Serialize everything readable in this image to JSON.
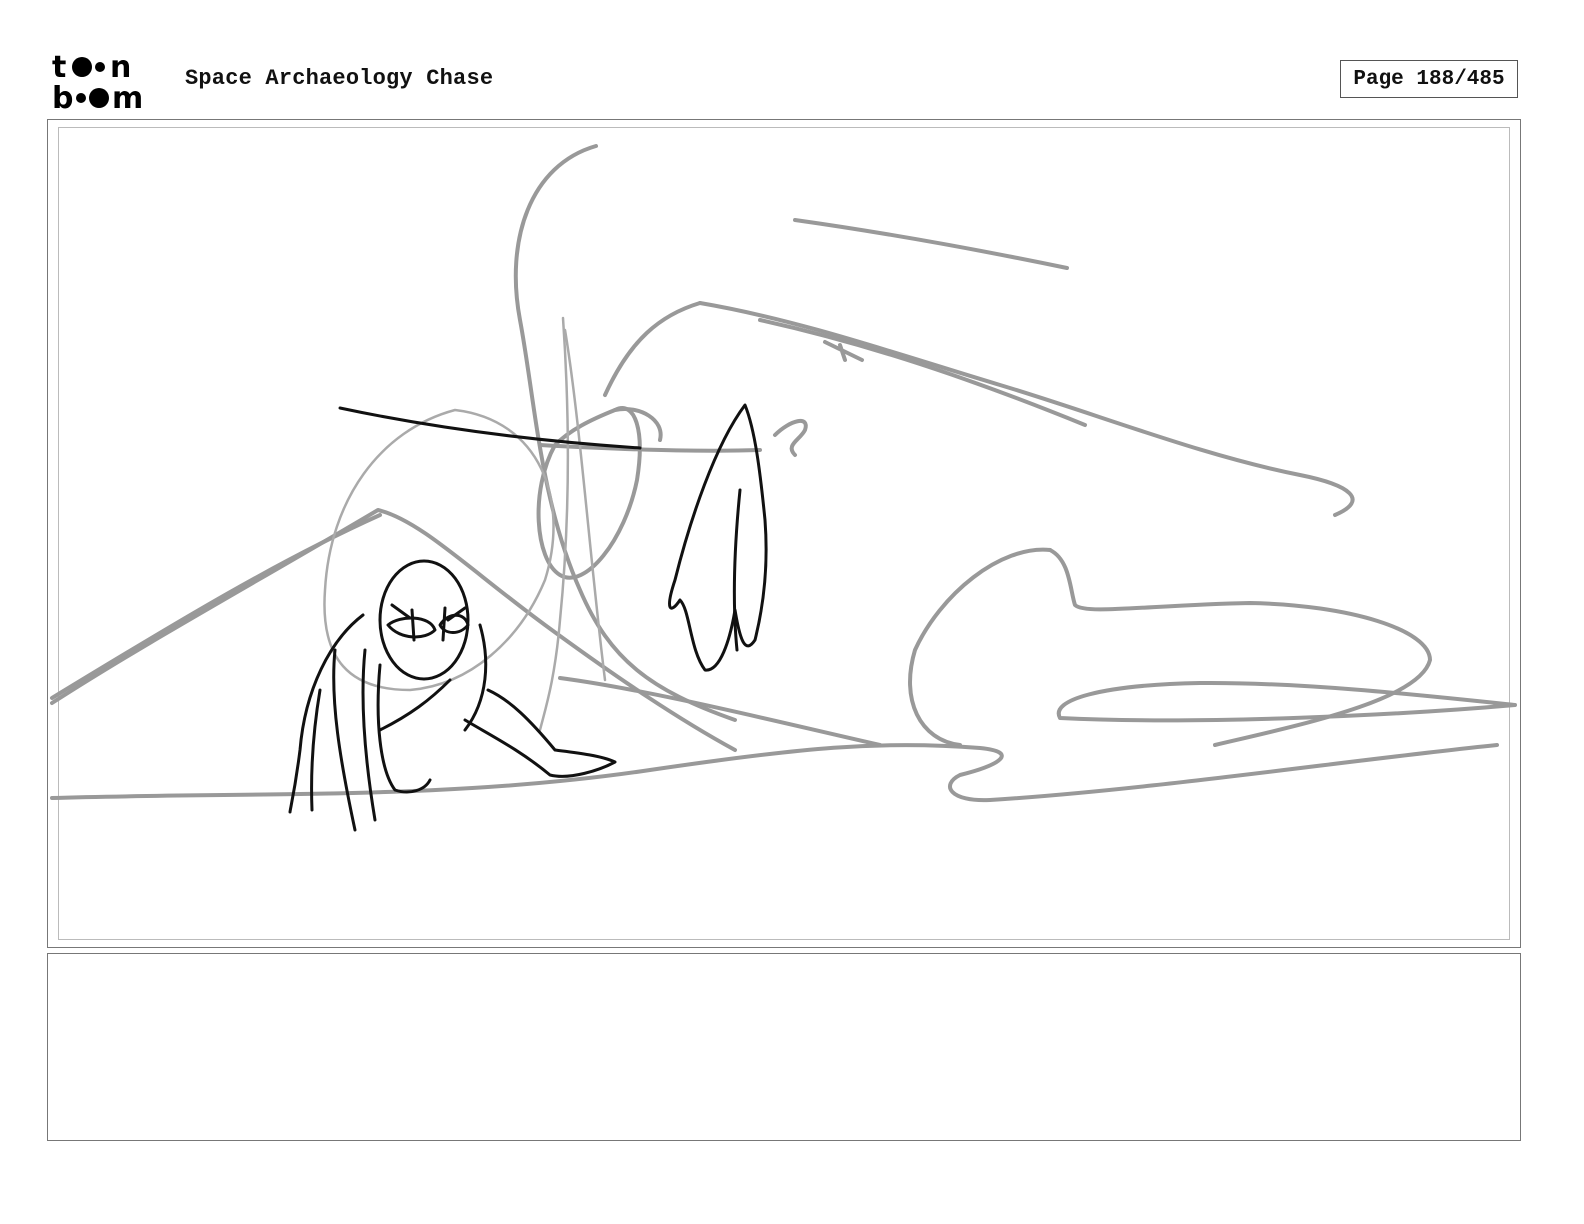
{
  "header": {
    "logo_lines": [
      "toon",
      "boom"
    ],
    "project_title": "Space Archaeology Chase",
    "page_label": "Page 188/485"
  },
  "panel": {
    "notes_text": ""
  },
  "colors": {
    "rough_sketch": "#999999",
    "ink_sketch": "#111111",
    "frame": "#777777"
  }
}
